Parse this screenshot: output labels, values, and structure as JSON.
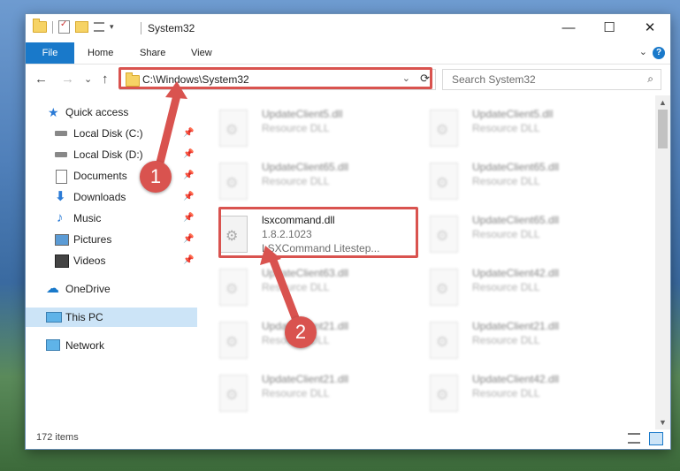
{
  "window": {
    "title": "System32",
    "controls": {
      "minimize": "—",
      "maximize": "☐",
      "close": "✕"
    }
  },
  "ribbon": {
    "tabs": [
      "File",
      "Home",
      "Share",
      "View"
    ],
    "help_icon": "?"
  },
  "nav": {
    "back": "←",
    "forward": "→",
    "recent": "⌄",
    "up": "↑",
    "address": "C:\\Windows\\System32",
    "address_dropdown": "⌄",
    "refresh": "⟳",
    "search_placeholder": "Search System32",
    "search_icon": "⌕"
  },
  "sidebar": {
    "items": [
      {
        "label": "Quick access",
        "icon": "star-icon",
        "pinned": false
      },
      {
        "label": "Local Disk (C:)",
        "icon": "drive-icon",
        "pinned": true
      },
      {
        "label": "Local Disk (D:)",
        "icon": "drive-icon",
        "pinned": true
      },
      {
        "label": "Documents",
        "icon": "documents-icon",
        "pinned": true
      },
      {
        "label": "Downloads",
        "icon": "download-icon",
        "pinned": true
      },
      {
        "label": "Music",
        "icon": "music-icon",
        "pinned": true
      },
      {
        "label": "Pictures",
        "icon": "pictures-icon",
        "pinned": true
      },
      {
        "label": "Videos",
        "icon": "videos-icon",
        "pinned": true
      },
      {
        "label": "OneDrive",
        "icon": "cloud-icon",
        "pinned": false
      },
      {
        "label": "This PC",
        "icon": "computer-icon",
        "pinned": false,
        "selected": true
      },
      {
        "label": "Network",
        "icon": "network-icon",
        "pinned": false
      }
    ]
  },
  "files": [
    {
      "name": "UpdateClient5.dll",
      "meta1": "Resource DLL",
      "meta2": "",
      "blurred": true
    },
    {
      "name": "UpdateClient5.dll",
      "meta1": "Resource DLL",
      "meta2": "",
      "blurred": true
    },
    {
      "name": "UpdateClient65.dll",
      "meta1": "Resource DLL",
      "meta2": "",
      "blurred": true
    },
    {
      "name": "UpdateClient65.dll",
      "meta1": "Resource DLL",
      "meta2": "",
      "blurred": true
    },
    {
      "name": "lsxcommand.dll",
      "meta1": "1.8.2.1023",
      "meta2": "LSXCommand Litestep...",
      "blurred": false
    },
    {
      "name": "UpdateClient65.dll",
      "meta1": "Resource DLL",
      "meta2": "",
      "blurred": true
    },
    {
      "name": "UpdateClient63.dll",
      "meta1": "Resource DLL",
      "meta2": "",
      "blurred": true
    },
    {
      "name": "UpdateClient42.dll",
      "meta1": "Resource DLL",
      "meta2": "",
      "blurred": true
    },
    {
      "name": "UpdateClient21.dll",
      "meta1": "Resource DLL",
      "meta2": "",
      "blurred": true
    },
    {
      "name": "UpdateClient21.dll",
      "meta1": "Resource DLL",
      "meta2": "",
      "blurred": true
    },
    {
      "name": "UpdateClient21.dll",
      "meta1": "Resource DLL",
      "meta2": "",
      "blurred": true
    },
    {
      "name": "UpdateClient42.dll",
      "meta1": "Resource DLL",
      "meta2": "",
      "blurred": true
    }
  ],
  "status": {
    "item_count": "172 items"
  },
  "callouts": [
    "1",
    "2"
  ],
  "colors": {
    "accent": "#1979ca",
    "highlight": "#d9534f",
    "selected_bg": "#cce4f7"
  }
}
